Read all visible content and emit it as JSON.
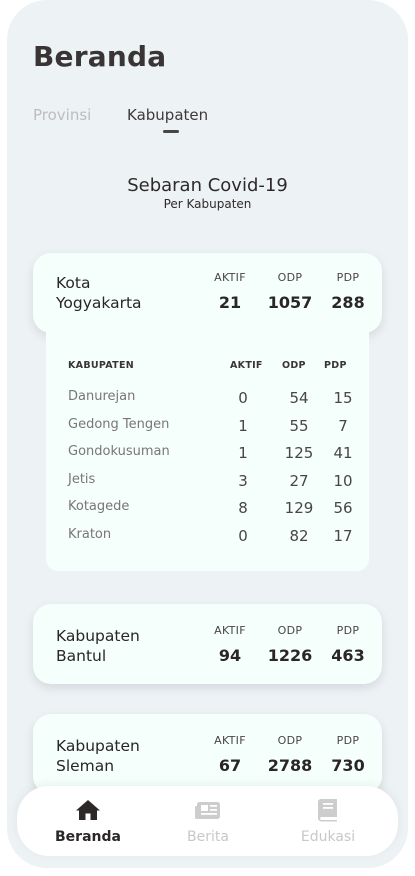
{
  "header": {
    "title": "Beranda"
  },
  "tabs": [
    {
      "label": "Provinsi",
      "active": false
    },
    {
      "label": "Kabupaten",
      "active": true
    }
  ],
  "section": {
    "title": "Sebaran Covid-19",
    "subtitle": "Per Kabupaten"
  },
  "stat_labels": {
    "aktif": "AKTIF",
    "odp": "ODP",
    "pdp": "PDP"
  },
  "regions": [
    {
      "type": "Kota",
      "name": "Yogyakarta",
      "aktif": "21",
      "odp": "1057",
      "pdp": "288"
    },
    {
      "type": "Kabupaten",
      "name": "Bantul",
      "aktif": "94",
      "odp": "1226",
      "pdp": "463"
    },
    {
      "type": "Kabupaten",
      "name": "Sleman",
      "aktif": "67",
      "odp": "2788",
      "pdp": "730"
    }
  ],
  "detail": {
    "headers": {
      "name": "KABUPATEN",
      "aktif": "AKTIF",
      "odp": "ODP",
      "pdp": "PDP"
    },
    "rows": [
      {
        "name": "Danurejan",
        "aktif": "0",
        "odp": "54",
        "pdp": "15"
      },
      {
        "name": "Gedong Tengen",
        "aktif": "1",
        "odp": "55",
        "pdp": "7"
      },
      {
        "name": "Gondokusuman",
        "aktif": "1",
        "odp": "125",
        "pdp": "41"
      },
      {
        "name": "Jetis",
        "aktif": "3",
        "odp": "27",
        "pdp": "10"
      },
      {
        "name": "Kotagede",
        "aktif": "8",
        "odp": "129",
        "pdp": "56"
      },
      {
        "name": "Kraton",
        "aktif": "0",
        "odp": "82",
        "pdp": "17"
      }
    ]
  },
  "nav": [
    {
      "label": "Beranda",
      "icon": "home-icon",
      "active": true
    },
    {
      "label": "Berita",
      "icon": "newspaper-icon",
      "active": false
    },
    {
      "label": "Edukasi",
      "icon": "book-icon",
      "active": false
    }
  ],
  "colors": {
    "background": "#edf2f5",
    "card": "#f5fffb",
    "text": "#2e2a2a",
    "muted": "#bdbdbd"
  }
}
